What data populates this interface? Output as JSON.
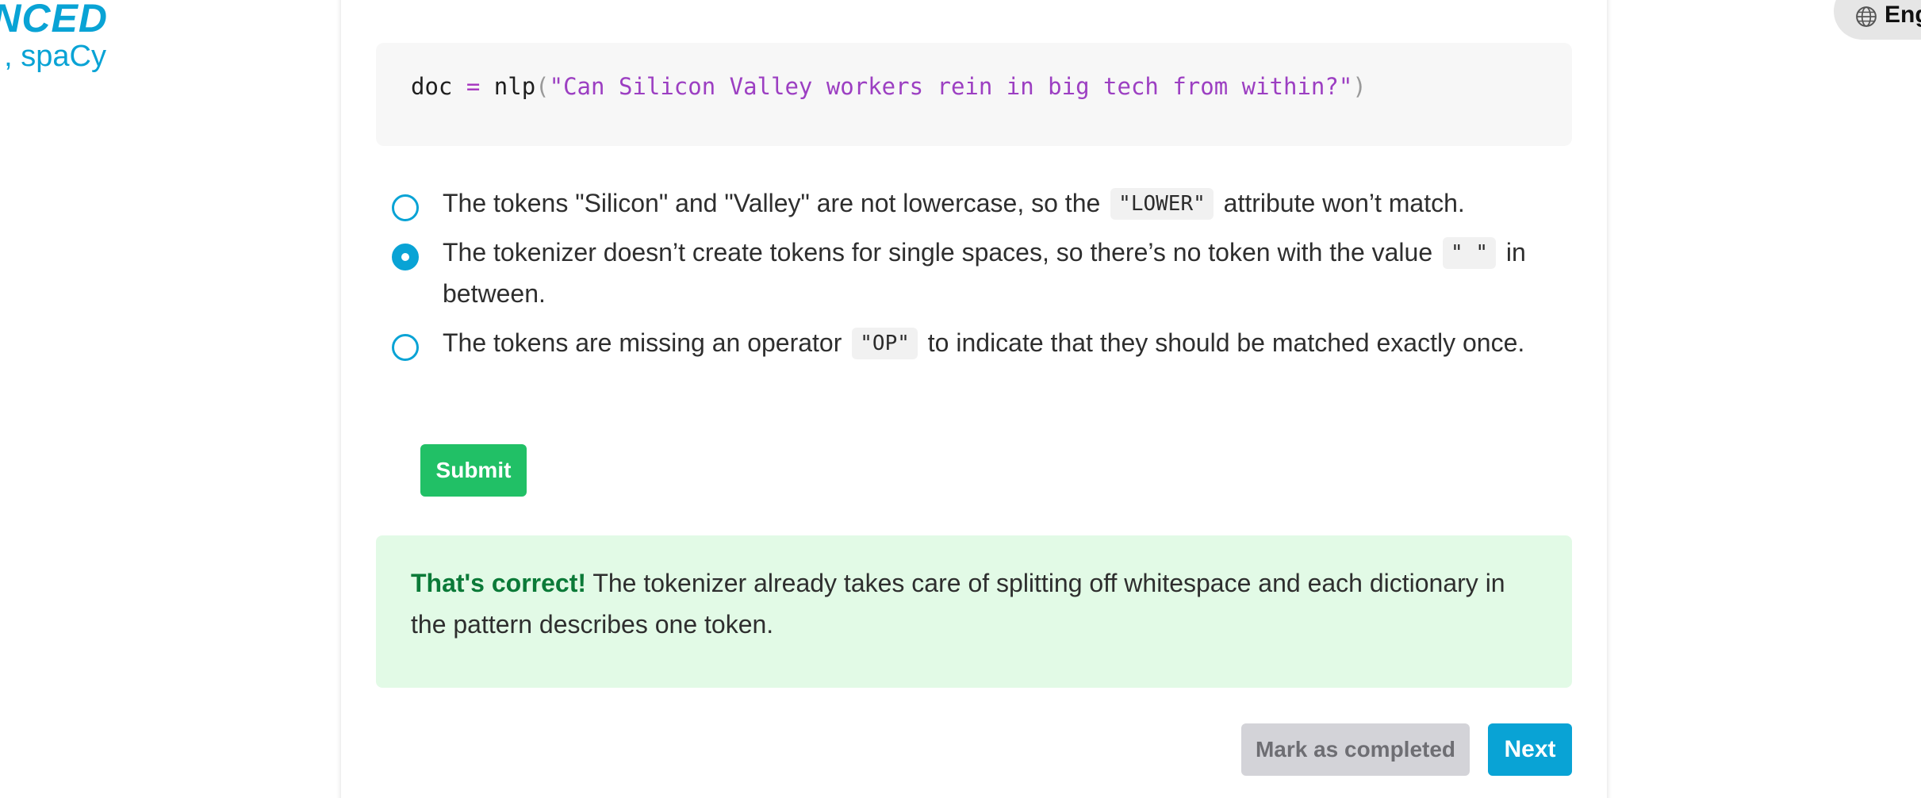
{
  "brand": {
    "line1": "NCED",
    "line2": ", spaCy"
  },
  "language": {
    "label": "Eng"
  },
  "code": {
    "var": "doc",
    "op": " = ",
    "func": "nlp",
    "paren_open": "(",
    "string": "\"Can Silicon Valley workers rein in big tech from within?\"",
    "paren_close": ")"
  },
  "options": [
    {
      "text_before": "The tokens \"Silicon\" and \"Valley\" are not lowercase, so the ",
      "code": "\"LOWER\"",
      "text_after": " attribute won’t match.",
      "selected": false
    },
    {
      "text_before": "The tokenizer doesn’t create tokens for single spaces, so there’s no token with the value ",
      "code": "\" \"",
      "text_after": " in between.",
      "selected": true
    },
    {
      "text_before": "The tokens are missing an operator ",
      "code": "\"OP\"",
      "text_after": " to indicate that they should be matched exactly once.",
      "selected": false
    }
  ],
  "submit_label": "Submit",
  "feedback": {
    "strong": "That's correct!",
    "text": " The tokenizer already takes care of splitting off whitespace and each dictionary in the pattern describes one token."
  },
  "footer": {
    "mark_label": "Mark as completed",
    "next_label": "Next"
  },
  "colors": {
    "accent": "#09a3d5",
    "submit": "#21c066",
    "feedback_bg": "#e2fae6",
    "feedback_strong": "#0b7a38",
    "mark_bg": "#d3d3d8"
  }
}
